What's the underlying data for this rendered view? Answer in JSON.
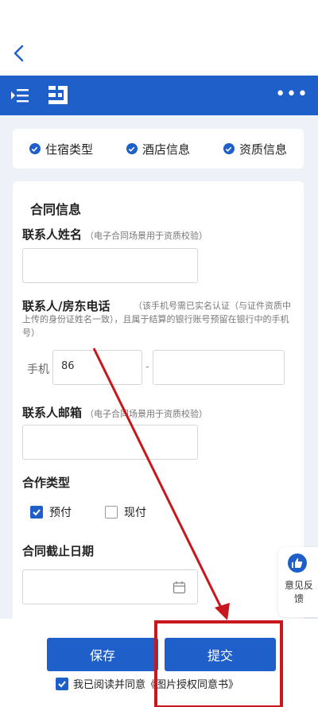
{
  "steps": [
    {
      "label": "住宿类型"
    },
    {
      "label": "酒店信息"
    },
    {
      "label": "资质信息"
    }
  ],
  "form": {
    "title": "合同信息",
    "contact_name": {
      "label": "联系人姓名",
      "hint": "（电子合同场景用于资质校验）",
      "value": ""
    },
    "phone": {
      "label": "联系人/房东电话",
      "hint": "（该手机号需已实名认证（与证件资质中上传的身份证姓名一致），且属于结算的银行账号预留在银行中的手机号）",
      "prefix": "手机",
      "country_code": "86",
      "separator": "-",
      "number": ""
    },
    "email": {
      "label": "联系人邮箱",
      "hint": "（电子合同场景用于资质校验）",
      "value": ""
    },
    "cooperation": {
      "label": "合作类型",
      "options": [
        {
          "label": "预付",
          "checked": true
        },
        {
          "label": "现付",
          "checked": false
        }
      ]
    },
    "deadline": {
      "label": "合同截止日期",
      "value": ""
    }
  },
  "feedback": {
    "label": "意见反馈"
  },
  "footer": {
    "save": "保存",
    "submit": "提交",
    "agreement": "我已阅读并同意《图片授权同意书》"
  },
  "colors": {
    "accent": "#1e5fc9",
    "annotation": "#c8171d"
  }
}
